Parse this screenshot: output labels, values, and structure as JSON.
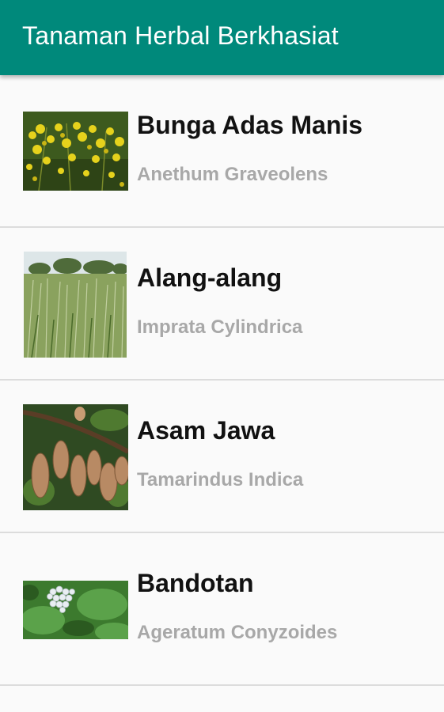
{
  "appbar": {
    "title": "Tanaman Herbal Berkhasiat",
    "color": "#00897b"
  },
  "plants": [
    {
      "name": "Bunga Adas Manis",
      "latin": "Anethum Graveolens",
      "image": "yellow-dill-flowers"
    },
    {
      "name": "Alang-alang",
      "latin": "Imprata Cylindrica",
      "image": "grass-field"
    },
    {
      "name": "Asam Jawa",
      "latin": "Tamarindus Indica",
      "image": "tamarind-pods"
    },
    {
      "name": "Bandotan",
      "latin": "Ageratum Conyzoides",
      "image": "white-flower-leaves"
    }
  ]
}
